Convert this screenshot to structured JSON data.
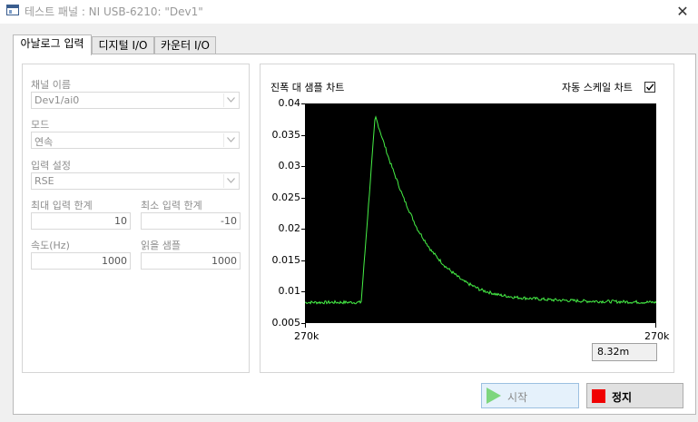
{
  "window": {
    "title": "테스트 패널 : NI USB-6210: \"Dev1\"",
    "close_glyph": "✕"
  },
  "tabs": [
    {
      "label": "아날로그 입력",
      "active": true
    },
    {
      "label": "디지털 I/O",
      "active": false
    },
    {
      "label": "카운터 I/O",
      "active": false
    }
  ],
  "settings": {
    "channel_label": "채널 이름",
    "channel_value": "Dev1/ai0",
    "mode_label": "모드",
    "mode_value": "연속",
    "input_config_label": "입력 설정",
    "input_config_value": "RSE",
    "max_label": "최대 입력 한계",
    "max_value": "10",
    "min_label": "최소 입력 한계",
    "min_value": "-10",
    "rate_label": "속도(Hz)",
    "rate_value": "1000",
    "samples_label": "읽을 샘플",
    "samples_value": "1000"
  },
  "chart": {
    "title": "진폭 대 샘플 차트",
    "autoscale_label": "자동 스케일 차트",
    "autoscale_checked": true,
    "cursor_readout": "8.32m",
    "trace_color": "#46f046"
  },
  "chart_data": {
    "type": "line",
    "title": "진폭 대 샘플 차트",
    "ylim": [
      0.005,
      0.04
    ],
    "y_ticks": [
      "0.04",
      "0.035",
      "0.03",
      "0.025",
      "0.02",
      "0.015",
      "0.01",
      "0.005"
    ],
    "x_tick_labels": [
      "270k",
      "270k"
    ],
    "x_range": [
      0,
      1000
    ],
    "series": [
      {
        "x": [
          0,
          160,
          200,
          240,
          280,
          320,
          360,
          400,
          450,
          500,
          550,
          600,
          700,
          800,
          900,
          1000
        ],
        "values": [
          0.0083,
          0.0083,
          0.038,
          0.031,
          0.025,
          0.02,
          0.0165,
          0.014,
          0.0117,
          0.0103,
          0.0095,
          0.0091,
          0.0087,
          0.0085,
          0.0084,
          0.0083
        ]
      }
    ]
  },
  "buttons": {
    "start_label": "시작",
    "stop_label": "정지"
  },
  "colors": {
    "plot_bg": "#000000",
    "stop_red": "#f00000",
    "start_green": "#7ed67e"
  }
}
